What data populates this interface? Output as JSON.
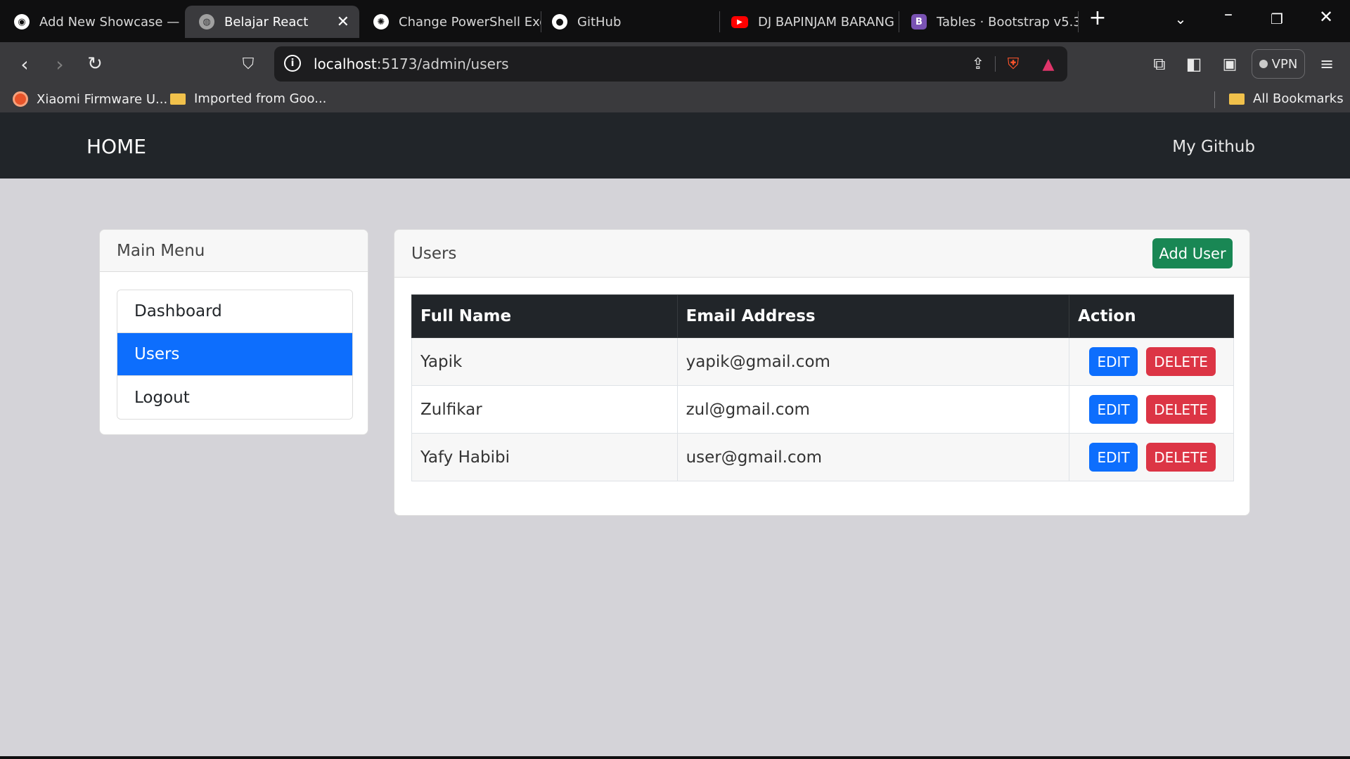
{
  "browser": {
    "tabs": [
      {
        "label": "Add New Showcase — ",
        "favicon": "github-desktop-icon"
      },
      {
        "label": "Belajar React",
        "favicon": "globe-icon",
        "active": true
      },
      {
        "label": "Change PowerShell Exe",
        "favicon": "chatgpt-icon"
      },
      {
        "label": "GitHub",
        "favicon": "github-icon"
      },
      {
        "label": "DJ BAPINJAM BARANG",
        "favicon": "youtube-icon"
      },
      {
        "label": "Tables · Bootstrap v5.3",
        "favicon": "bootstrap-icon"
      }
    ],
    "close_tab_glyph": "✕",
    "new_tab_glyph": "+",
    "address": {
      "host": "localhost",
      "path": ":5173/admin/users"
    },
    "vpn_label": "VPN",
    "bookmarks": [
      {
        "label": "Xiaomi Firmware U...",
        "icon": "xiaomi-icon"
      },
      {
        "label": "Imported from Goo...",
        "icon": "folder-icon"
      }
    ],
    "all_bookmarks": "All Bookmarks"
  },
  "navbar": {
    "brand": "HOME",
    "link": "My Github"
  },
  "menu": {
    "title": "Main Menu",
    "items": [
      {
        "label": "Dashboard",
        "active": false
      },
      {
        "label": "Users",
        "active": true
      },
      {
        "label": "Logout",
        "active": false
      }
    ]
  },
  "users": {
    "title": "Users",
    "add_label": "Add User",
    "columns": [
      "Full Name",
      "Email Address",
      "Action"
    ],
    "rows": [
      {
        "name": "Yapik",
        "email": "yapik@gmail.com"
      },
      {
        "name": "Zulfikar",
        "email": "zul@gmail.com"
      },
      {
        "name": "Yafy Habibi",
        "email": "user@gmail.com"
      }
    ],
    "edit_label": "EDIT",
    "delete_label": "DELETE"
  },
  "colors": {
    "primary": "#0d6efd",
    "success": "#198754",
    "danger": "#dc3545",
    "dark": "#212529",
    "page_bg": "#d4d3d8"
  }
}
